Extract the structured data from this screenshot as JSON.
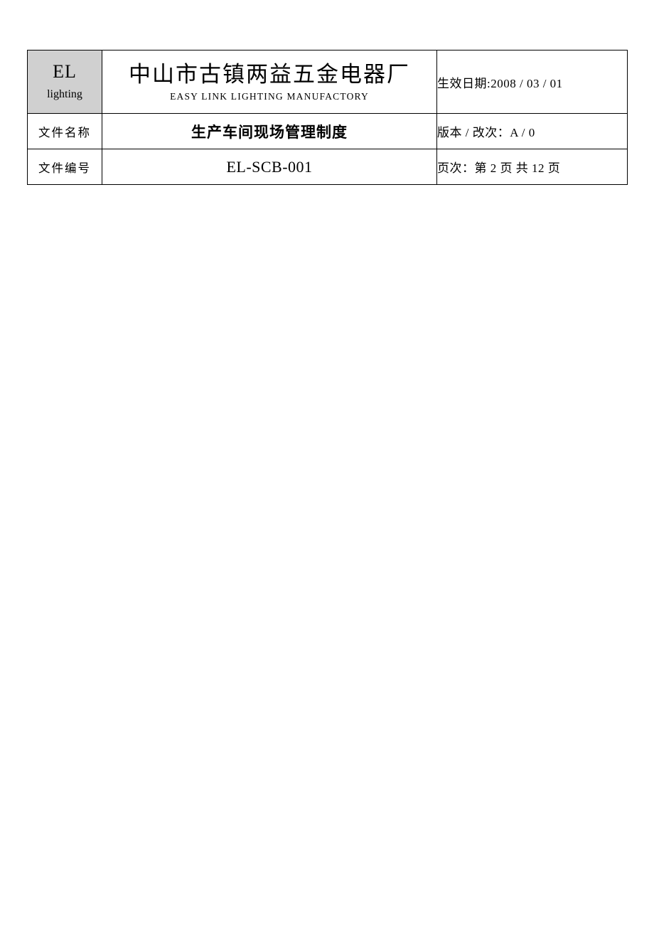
{
  "document": {
    "header_table": {
      "rows": [
        {
          "logo": {
            "mark": "EL",
            "sub": "lighting"
          },
          "company_cn": "中山市古镇两益五金电器厂",
          "company_en": "EASY   LINK   LIGHTING   MANUFACTORY",
          "meta": "生效日期:2008 / 03 / 01"
        },
        {
          "label": "文件名称",
          "value": "生产车间现场管理制度",
          "meta": "版本 / 改次：A / 0"
        },
        {
          "label": "文件编号",
          "value": "EL-SCB-001",
          "meta": "页次：第 2 页 共 12 页"
        }
      ]
    },
    "colors": {
      "logo_background": "#bfbfbf",
      "border": "#000000",
      "text": "#000000",
      "page_background": "#ffffff"
    }
  }
}
